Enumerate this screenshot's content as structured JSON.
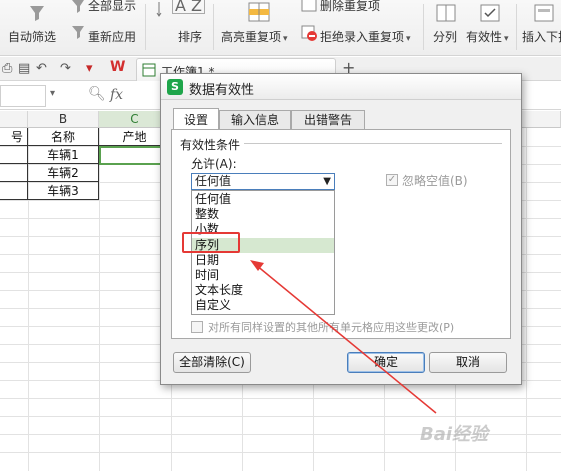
{
  "ribbon": {
    "auto_filter": "自动筛选",
    "show_all": "全部显示",
    "reapply": "重新应用",
    "sort": "排序",
    "highlight_dup": "高亮重复项",
    "delete_dup": "删除重复项",
    "reject_dup": "拒绝录入重复项",
    "split": "分列",
    "validity": "有效性",
    "insert_dropdown": "插入下拉"
  },
  "doc_tab": {
    "title": "工作簿1 *"
  },
  "formula_bar": {
    "fx": "fx"
  },
  "sheet": {
    "columns": [
      "B",
      "C"
    ],
    "header_row": {
      "col_a": "号",
      "col_b": "名称",
      "col_c": "产地"
    },
    "rows": [
      "车辆1",
      "车辆2",
      "车辆3"
    ]
  },
  "dialog": {
    "title": "数据有效性",
    "tabs": [
      "设置",
      "输入信息",
      "出错警告"
    ],
    "group_title": "有效性条件",
    "allow_label": "允许(A):",
    "selected": "任何值",
    "options": [
      "任何值",
      "整数",
      "小数",
      "序列",
      "日期",
      "时间",
      "文本长度",
      "自定义"
    ],
    "ignore_blank": "忽略空值(B)",
    "apply_all": "对所有同样设置的其他所有单元格应用这些更改(P)",
    "clear_all": "全部清除(C)",
    "ok": "确定",
    "cancel": "取消"
  },
  "colors": {
    "accent": "#1ea54a",
    "highlight": "#d6e8d0",
    "annotation": "#e53935"
  }
}
